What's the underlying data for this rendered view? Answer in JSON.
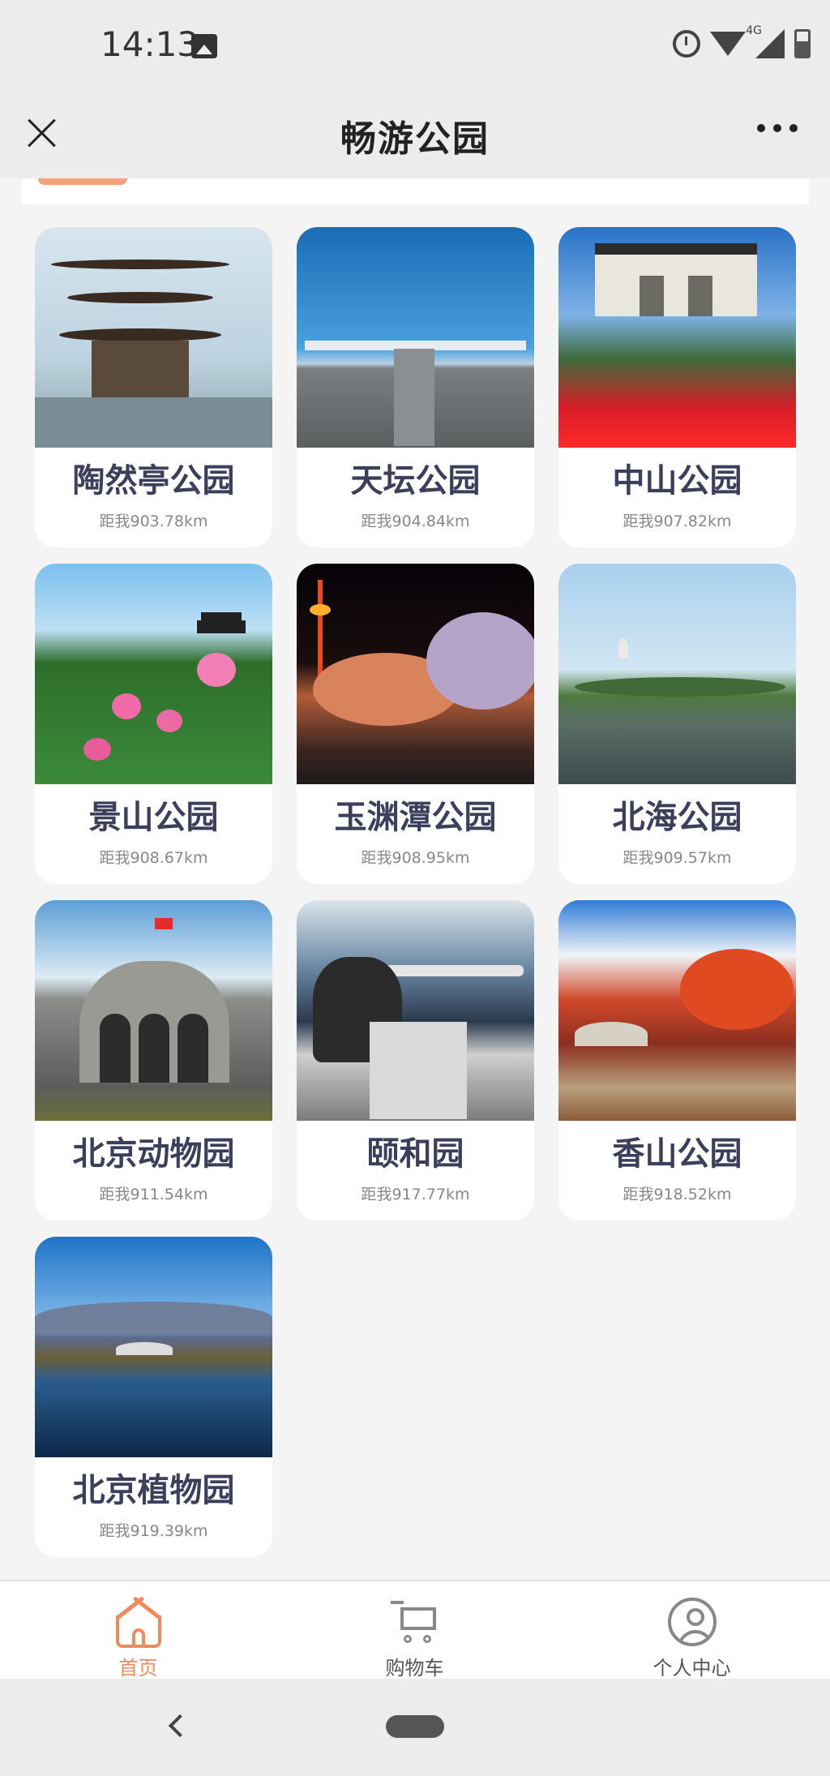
{
  "status_bar": {
    "time": "14:13",
    "network": "4G"
  },
  "header": {
    "title": "畅游公园"
  },
  "parks": [
    {
      "name": "陶然亭公园",
      "distance": "距我903.78km"
    },
    {
      "name": "天坛公园",
      "distance": "距我904.84km"
    },
    {
      "name": "中山公园",
      "distance": "距我907.82km"
    },
    {
      "name": "景山公园",
      "distance": "距我908.67km"
    },
    {
      "name": "玉渊潭公园",
      "distance": "距我908.95km"
    },
    {
      "name": "北海公园",
      "distance": "距我909.57km"
    },
    {
      "name": "北京动物园",
      "distance": "距我911.54km"
    },
    {
      "name": "颐和园",
      "distance": "距我917.77km"
    },
    {
      "name": "香山公园",
      "distance": "距我918.52km"
    },
    {
      "name": "北京植物园",
      "distance": "距我919.39km"
    }
  ],
  "tabs": [
    {
      "label": "首页",
      "icon": "home-icon",
      "active": true
    },
    {
      "label": "购物车",
      "icon": "cart-icon",
      "active": false
    },
    {
      "label": "个人中心",
      "icon": "user-icon",
      "active": false
    }
  ],
  "colors": {
    "accent": "#f08a5d",
    "title_text": "#3b3f5c",
    "background": "#f4f4f4"
  }
}
